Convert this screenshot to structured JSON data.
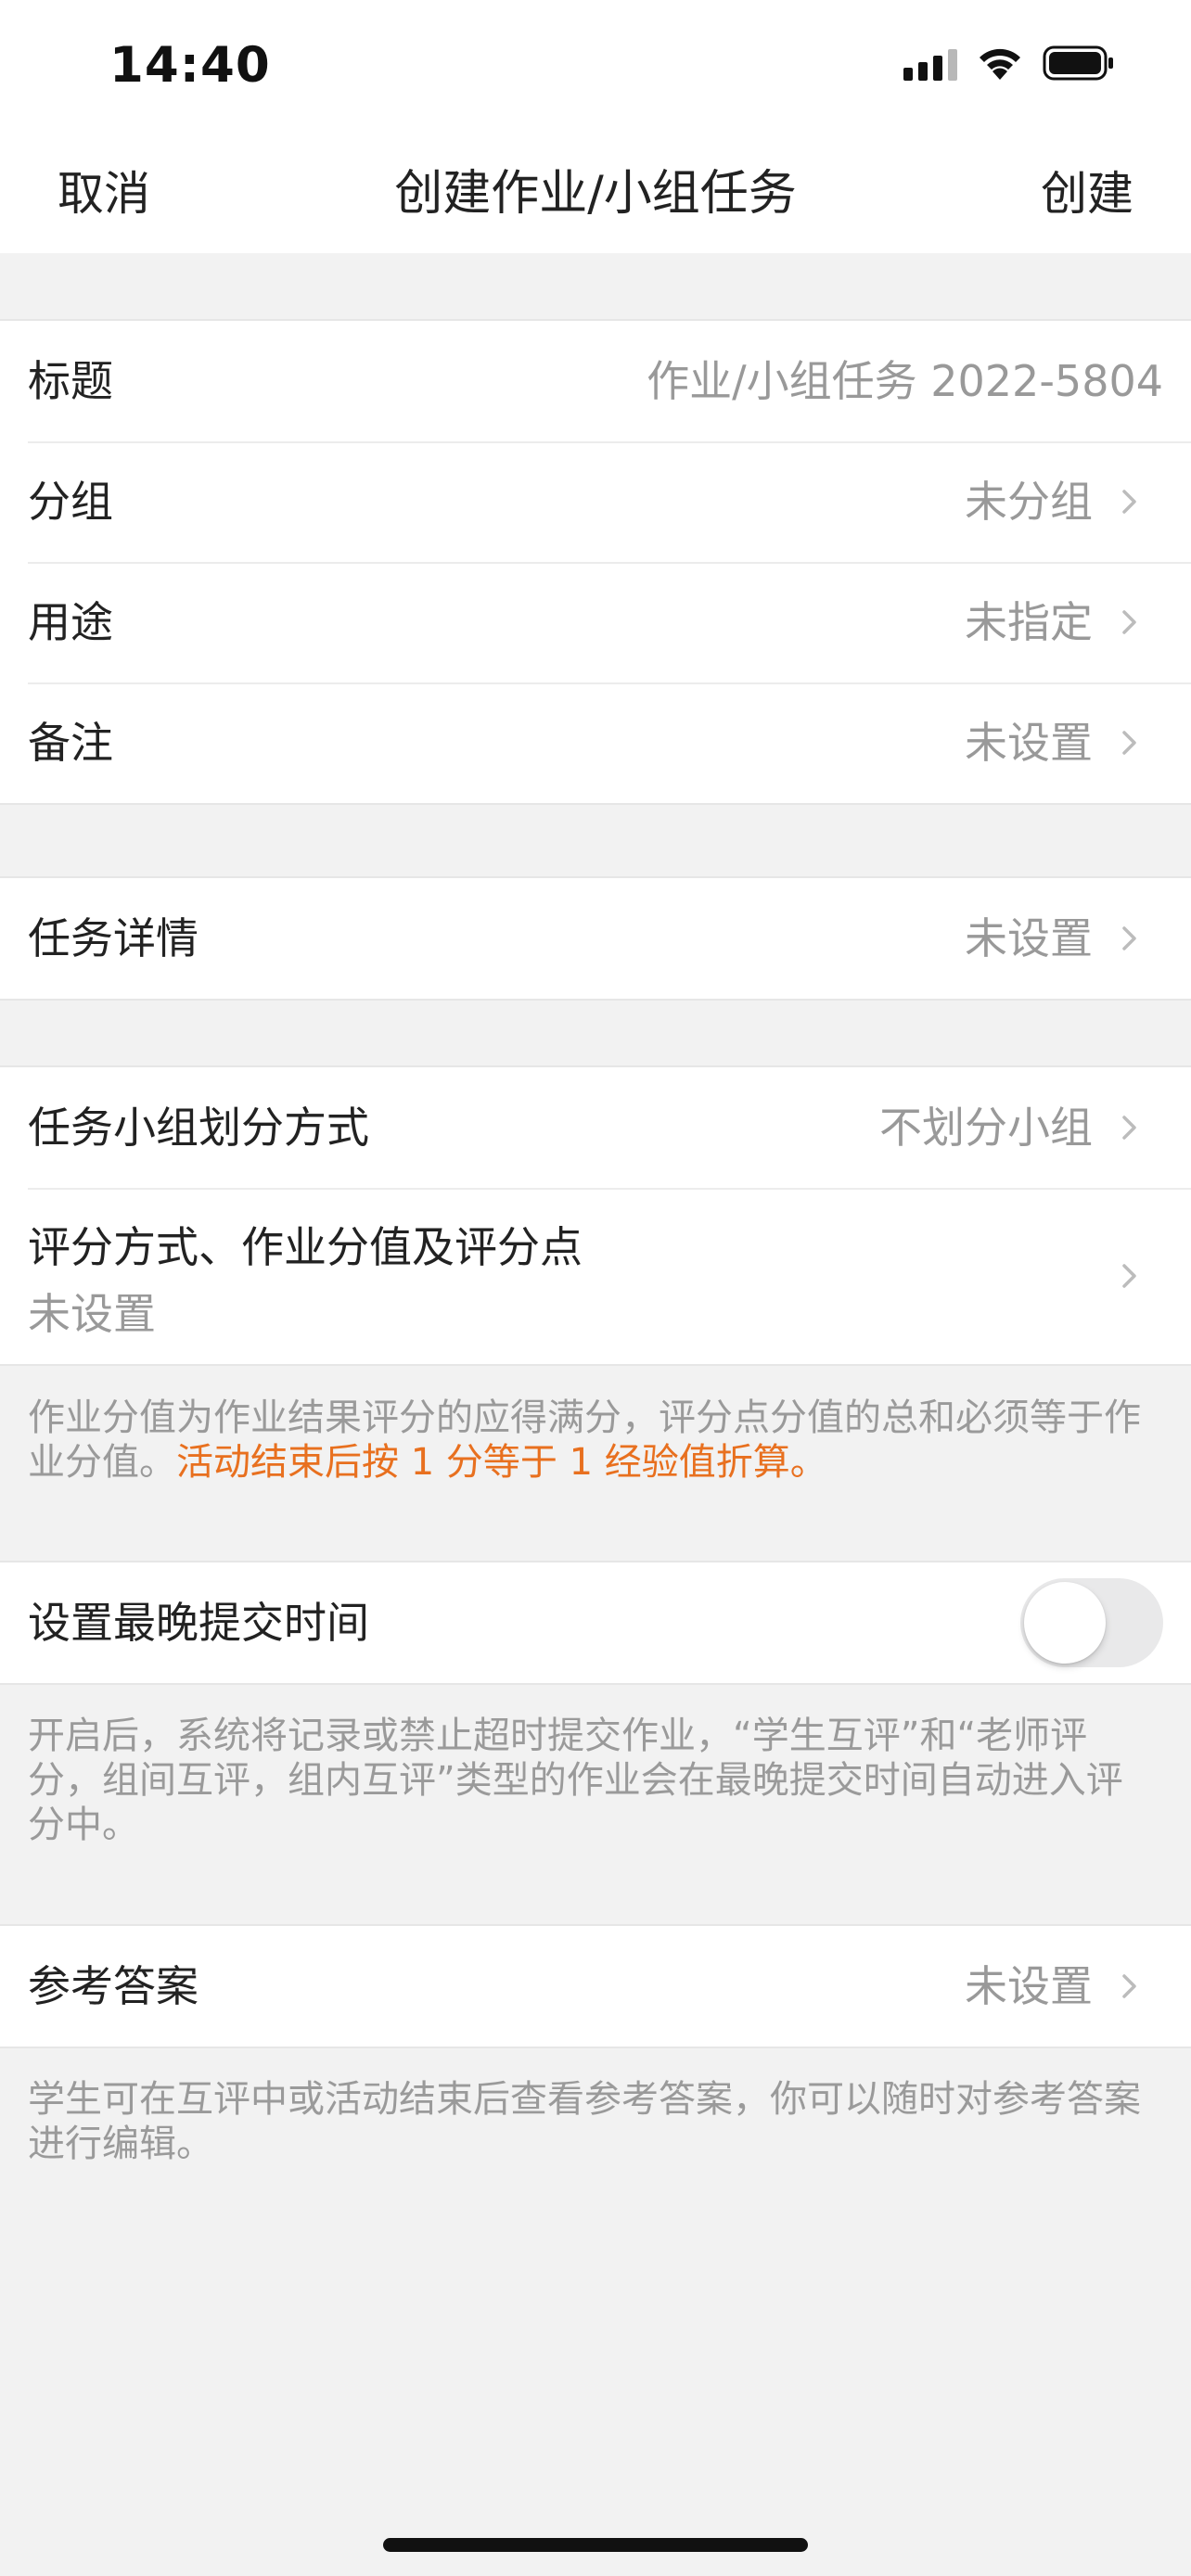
{
  "status_bar": {
    "time": "14:40",
    "icons": [
      "signal-icon",
      "wifi-icon",
      "battery-icon"
    ]
  },
  "nav": {
    "cancel": "取消",
    "title": "创建作业/小组任务",
    "create": "创建"
  },
  "basic": {
    "title_label": "标题",
    "title_value": "作业/小组任务 2022-5804",
    "group_label": "分组",
    "group_value": "未分组",
    "purpose_label": "用途",
    "purpose_value": "未指定",
    "remark_label": "备注",
    "remark_value": "未设置"
  },
  "task_details": {
    "label": "任务详情",
    "value": "未设置"
  },
  "grouping": {
    "division_label": "任务小组划分方式",
    "division_value": "不划分小组",
    "scoring_label": "评分方式、作业分值及评分点",
    "scoring_value": "未设置",
    "note_text": "作业分值为作业结果评分的应得满分，评分点分值的总和必须等于作业分值。",
    "note_highlight": "活动结束后按 1 分等于 1 经验值折算。"
  },
  "deadline": {
    "label": "设置最晚提交时间",
    "enabled": false,
    "note": "开启后，系统将记录或禁止超时提交作业，“学生互评”和“老师评分，组间互评，组内互评”类型的作业会在最晚提交时间自动进入评分中。"
  },
  "answer": {
    "label": "参考答案",
    "value": "未设置",
    "note": "学生可在互评中或活动结束后查看参考答案，你可以随时对参考答案进行编辑。"
  },
  "colors": {
    "accent_orange": "#e8701f",
    "secondary_text": "#999999",
    "background": "#f2f2f2"
  }
}
